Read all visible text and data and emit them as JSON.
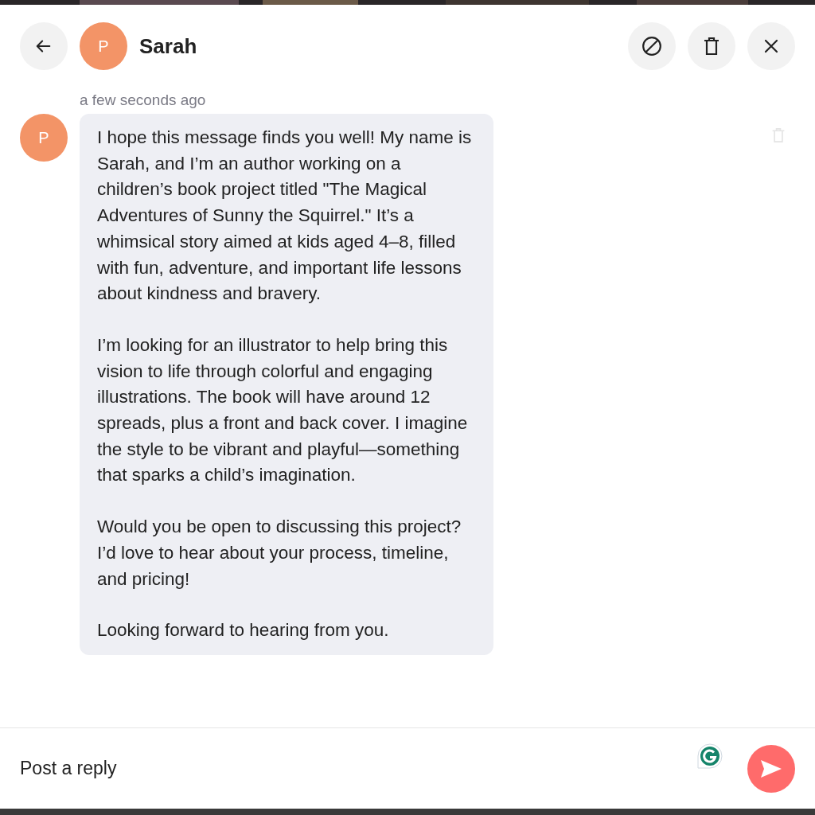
{
  "header": {
    "avatar_initial": "P",
    "name": "Sarah"
  },
  "message": {
    "time": "a few seconds ago",
    "avatar_initial": "P",
    "paragraphs": [
      "I hope this message finds you well! My name is Sarah, and I’m an author working on a children’s book project titled \"The Magical Adventures of Sunny the Squirrel.\" It’s a whimsical story aimed at kids aged 4–8, filled with fun, adventure, and important life lessons about kindness and bravery.",
      "I’m looking for an illustrator to help bring this vision to life through colorful and engaging illustrations. The book will have around 12 spreads, plus a front and back cover. I imagine the style to be vibrant and playful—something that sparks a child’s imagination.",
      "Would you be open to discussing this project? I’d love to hear about your process, timeline, and pricing!",
      "Looking forward to hearing from you."
    ]
  },
  "reply": {
    "placeholder": "Post a reply"
  }
}
